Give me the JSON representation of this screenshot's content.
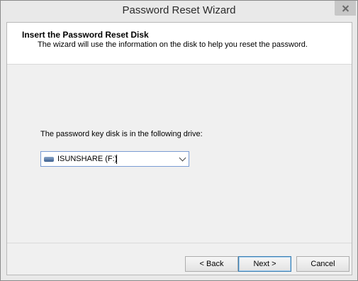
{
  "window": {
    "title": "Password Reset Wizard"
  },
  "header": {
    "title": "Insert the Password Reset Disk",
    "subtitle": "The wizard will use the information on the disk to help you reset the password."
  },
  "body": {
    "prompt": "The password key disk is in the following drive:",
    "drive_select": {
      "value": "ISUNSHARE (F:)",
      "icon": "usb-drive-icon"
    }
  },
  "buttons": {
    "back": "< Back",
    "next": "Next >",
    "cancel": "Cancel"
  },
  "colors": {
    "accent": "#3c7fb1",
    "close_button": "#c7c7c7"
  }
}
